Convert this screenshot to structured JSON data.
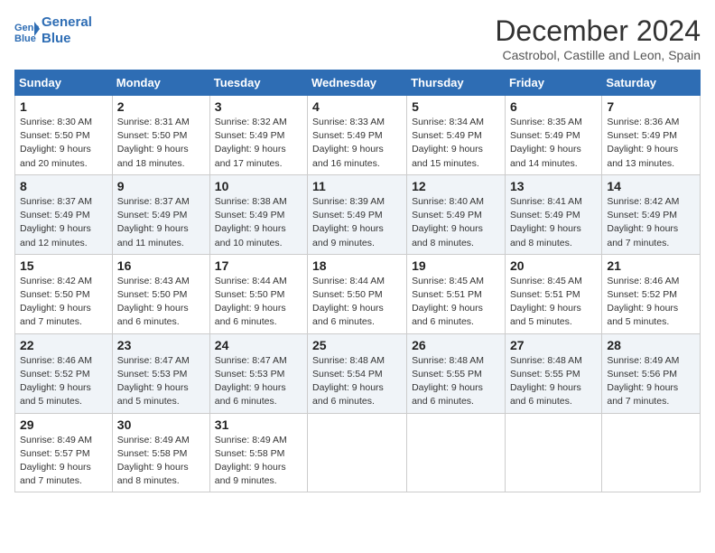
{
  "header": {
    "logo_line1": "General",
    "logo_line2": "Blue",
    "month_title": "December 2024",
    "subtitle": "Castrobol, Castille and Leon, Spain"
  },
  "weekdays": [
    "Sunday",
    "Monday",
    "Tuesday",
    "Wednesday",
    "Thursday",
    "Friday",
    "Saturday"
  ],
  "weeks": [
    [
      {
        "day": "1",
        "sunrise": "Sunrise: 8:30 AM",
        "sunset": "Sunset: 5:50 PM",
        "daylight": "Daylight: 9 hours and 20 minutes."
      },
      {
        "day": "2",
        "sunrise": "Sunrise: 8:31 AM",
        "sunset": "Sunset: 5:50 PM",
        "daylight": "Daylight: 9 hours and 18 minutes."
      },
      {
        "day": "3",
        "sunrise": "Sunrise: 8:32 AM",
        "sunset": "Sunset: 5:49 PM",
        "daylight": "Daylight: 9 hours and 17 minutes."
      },
      {
        "day": "4",
        "sunrise": "Sunrise: 8:33 AM",
        "sunset": "Sunset: 5:49 PM",
        "daylight": "Daylight: 9 hours and 16 minutes."
      },
      {
        "day": "5",
        "sunrise": "Sunrise: 8:34 AM",
        "sunset": "Sunset: 5:49 PM",
        "daylight": "Daylight: 9 hours and 15 minutes."
      },
      {
        "day": "6",
        "sunrise": "Sunrise: 8:35 AM",
        "sunset": "Sunset: 5:49 PM",
        "daylight": "Daylight: 9 hours and 14 minutes."
      },
      {
        "day": "7",
        "sunrise": "Sunrise: 8:36 AM",
        "sunset": "Sunset: 5:49 PM",
        "daylight": "Daylight: 9 hours and 13 minutes."
      }
    ],
    [
      {
        "day": "8",
        "sunrise": "Sunrise: 8:37 AM",
        "sunset": "Sunset: 5:49 PM",
        "daylight": "Daylight: 9 hours and 12 minutes."
      },
      {
        "day": "9",
        "sunrise": "Sunrise: 8:37 AM",
        "sunset": "Sunset: 5:49 PM",
        "daylight": "Daylight: 9 hours and 11 minutes."
      },
      {
        "day": "10",
        "sunrise": "Sunrise: 8:38 AM",
        "sunset": "Sunset: 5:49 PM",
        "daylight": "Daylight: 9 hours and 10 minutes."
      },
      {
        "day": "11",
        "sunrise": "Sunrise: 8:39 AM",
        "sunset": "Sunset: 5:49 PM",
        "daylight": "Daylight: 9 hours and 9 minutes."
      },
      {
        "day": "12",
        "sunrise": "Sunrise: 8:40 AM",
        "sunset": "Sunset: 5:49 PM",
        "daylight": "Daylight: 9 hours and 8 minutes."
      },
      {
        "day": "13",
        "sunrise": "Sunrise: 8:41 AM",
        "sunset": "Sunset: 5:49 PM",
        "daylight": "Daylight: 9 hours and 8 minutes."
      },
      {
        "day": "14",
        "sunrise": "Sunrise: 8:42 AM",
        "sunset": "Sunset: 5:49 PM",
        "daylight": "Daylight: 9 hours and 7 minutes."
      }
    ],
    [
      {
        "day": "15",
        "sunrise": "Sunrise: 8:42 AM",
        "sunset": "Sunset: 5:50 PM",
        "daylight": "Daylight: 9 hours and 7 minutes."
      },
      {
        "day": "16",
        "sunrise": "Sunrise: 8:43 AM",
        "sunset": "Sunset: 5:50 PM",
        "daylight": "Daylight: 9 hours and 6 minutes."
      },
      {
        "day": "17",
        "sunrise": "Sunrise: 8:44 AM",
        "sunset": "Sunset: 5:50 PM",
        "daylight": "Daylight: 9 hours and 6 minutes."
      },
      {
        "day": "18",
        "sunrise": "Sunrise: 8:44 AM",
        "sunset": "Sunset: 5:50 PM",
        "daylight": "Daylight: 9 hours and 6 minutes."
      },
      {
        "day": "19",
        "sunrise": "Sunrise: 8:45 AM",
        "sunset": "Sunset: 5:51 PM",
        "daylight": "Daylight: 9 hours and 6 minutes."
      },
      {
        "day": "20",
        "sunrise": "Sunrise: 8:45 AM",
        "sunset": "Sunset: 5:51 PM",
        "daylight": "Daylight: 9 hours and 5 minutes."
      },
      {
        "day": "21",
        "sunrise": "Sunrise: 8:46 AM",
        "sunset": "Sunset: 5:52 PM",
        "daylight": "Daylight: 9 hours and 5 minutes."
      }
    ],
    [
      {
        "day": "22",
        "sunrise": "Sunrise: 8:46 AM",
        "sunset": "Sunset: 5:52 PM",
        "daylight": "Daylight: 9 hours and 5 minutes."
      },
      {
        "day": "23",
        "sunrise": "Sunrise: 8:47 AM",
        "sunset": "Sunset: 5:53 PM",
        "daylight": "Daylight: 9 hours and 5 minutes."
      },
      {
        "day": "24",
        "sunrise": "Sunrise: 8:47 AM",
        "sunset": "Sunset: 5:53 PM",
        "daylight": "Daylight: 9 hours and 6 minutes."
      },
      {
        "day": "25",
        "sunrise": "Sunrise: 8:48 AM",
        "sunset": "Sunset: 5:54 PM",
        "daylight": "Daylight: 9 hours and 6 minutes."
      },
      {
        "day": "26",
        "sunrise": "Sunrise: 8:48 AM",
        "sunset": "Sunset: 5:55 PM",
        "daylight": "Daylight: 9 hours and 6 minutes."
      },
      {
        "day": "27",
        "sunrise": "Sunrise: 8:48 AM",
        "sunset": "Sunset: 5:55 PM",
        "daylight": "Daylight: 9 hours and 6 minutes."
      },
      {
        "day": "28",
        "sunrise": "Sunrise: 8:49 AM",
        "sunset": "Sunset: 5:56 PM",
        "daylight": "Daylight: 9 hours and 7 minutes."
      }
    ],
    [
      {
        "day": "29",
        "sunrise": "Sunrise: 8:49 AM",
        "sunset": "Sunset: 5:57 PM",
        "daylight": "Daylight: 9 hours and 7 minutes."
      },
      {
        "day": "30",
        "sunrise": "Sunrise: 8:49 AM",
        "sunset": "Sunset: 5:58 PM",
        "daylight": "Daylight: 9 hours and 8 minutes."
      },
      {
        "day": "31",
        "sunrise": "Sunrise: 8:49 AM",
        "sunset": "Sunset: 5:58 PM",
        "daylight": "Daylight: 9 hours and 9 minutes."
      },
      null,
      null,
      null,
      null
    ]
  ]
}
